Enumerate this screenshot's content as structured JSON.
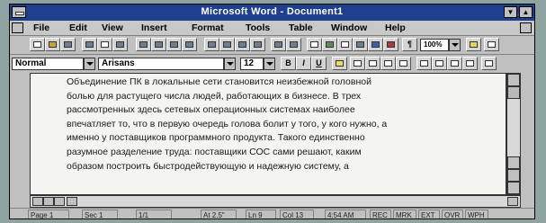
{
  "window": {
    "title": "Microsoft Word - Document1",
    "colors": {
      "titlebar": "#1f3f8f",
      "chrome": "#c0c0c0",
      "document": "#f4f4f0"
    }
  },
  "menu": {
    "items": [
      "File",
      "Edit",
      "View",
      "Insert",
      "Format",
      "Tools",
      "Table",
      "Window",
      "Help"
    ]
  },
  "toolbar": {
    "zoom": "100%",
    "pilcrow": "¶"
  },
  "format_bar": {
    "style": "Normal",
    "font": "Arisans",
    "size": "12",
    "bold": "B",
    "italic": "I",
    "underline": "U"
  },
  "document": {
    "lines": [
      "Объединение ПК в локальные сети становится неизбежной головной",
      "болью для растущего числа людей, работающих в бизнесе. В трех",
      "рассмотренных здесь сетевых операционных системах наиболее",
      "впечатляет то, что в первую очередь голова болит у того, у кого нужно, а",
      "именно у поставщиков программного продукта. Такого единственно",
      "разумное разделение труда: поставщики СОС сами решают, каким",
      "образом построить быстродействующую и надежную систему, а"
    ]
  },
  "status": {
    "page": "Page 1",
    "section": "Sec 1",
    "page_of": "1/1",
    "at": "At 2.5\"",
    "line": "Ln 9",
    "col": "Col 13",
    "time": "4:54 AM",
    "indicators": [
      "REC",
      "MRK",
      "EXT",
      "OVR",
      "WPH"
    ]
  }
}
